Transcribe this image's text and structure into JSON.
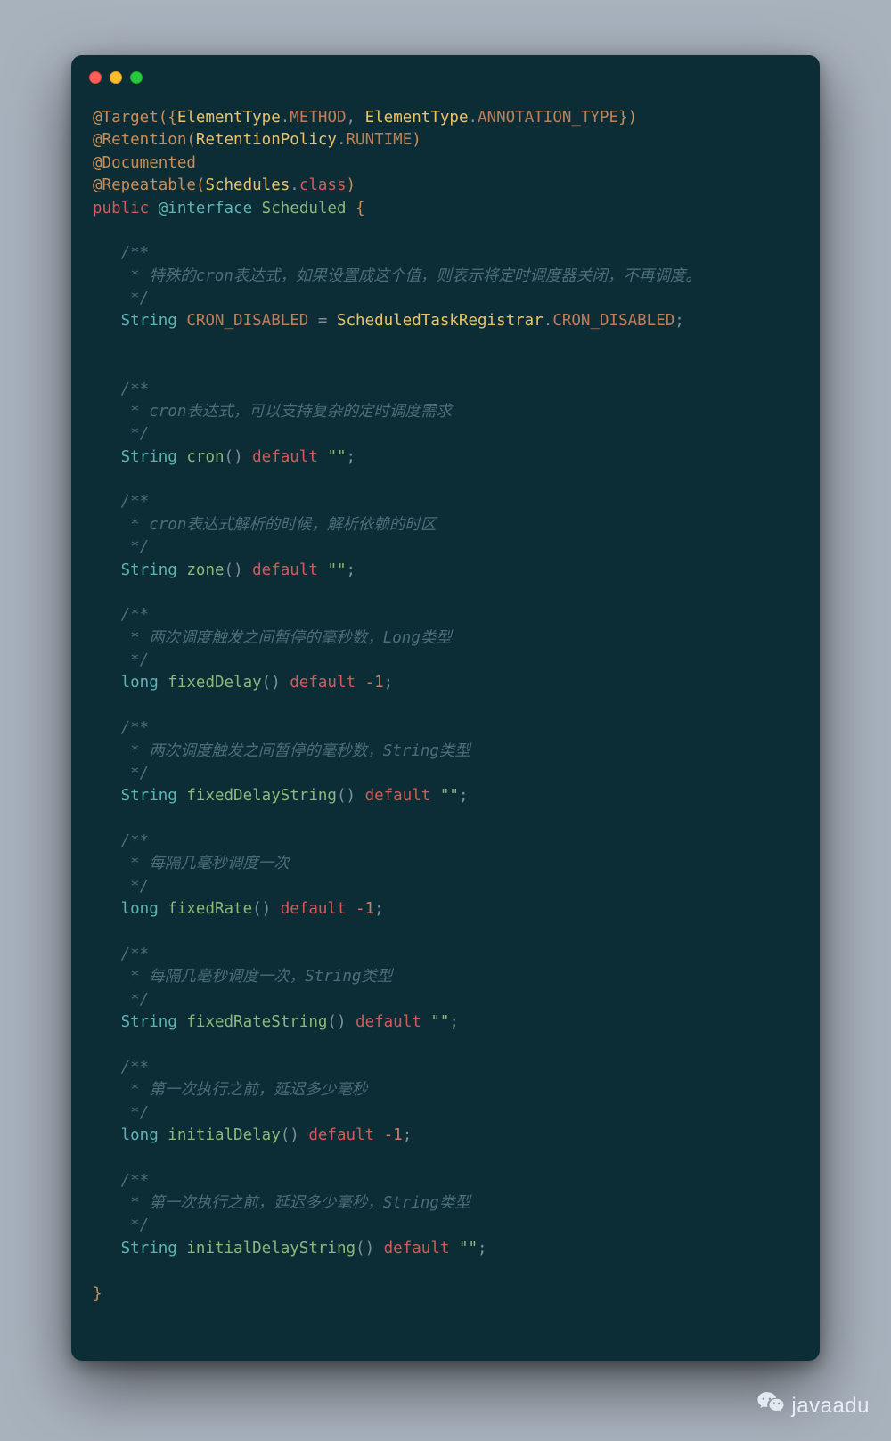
{
  "watermark_text": "javaadu",
  "code": {
    "line1": {
      "at": "@Target",
      "paren_open": "({",
      "t1": "ElementType",
      "dot1": ".",
      "c1": "METHOD",
      "comma": ", ",
      "t2": "ElementType",
      "dot2": ".",
      "c2": "ANNOTATION_TYPE",
      "paren_close": "})"
    },
    "line2": {
      "at": "@Retention",
      "paren_open": "(",
      "t": "RetentionPolicy",
      "dot": ".",
      "c": "RUNTIME",
      "paren_close": ")"
    },
    "line3": {
      "at": "@Documented"
    },
    "line4": {
      "at": "@Repeatable",
      "paren_open": "(",
      "t": "Schedules",
      "dot": ".",
      "c": "class",
      "paren_close": ")"
    },
    "line5": {
      "public": "public ",
      "ainterface": "@interface ",
      "name": "Scheduled ",
      "brace_open": "{"
    },
    "member1": {
      "comment_open": "/**",
      "comment_body": " * 特殊的cron表达式，如果设置成这个值，则表示将定时调度器关闭，不再调度。",
      "comment_close": " */",
      "type": "String ",
      "name": "CRON_DISABLED ",
      "eq": "= ",
      "rhs1": "ScheduledTaskRegistrar",
      "dot": ".",
      "rhs2": "CRON_DISABLED",
      "semi": ";"
    },
    "member2": {
      "comment_open": "/**",
      "comment_body": " * cron表达式，可以支持复杂的定时调度需求",
      "comment_close": " */",
      "type": "String ",
      "name": "cron",
      "parens": "() ",
      "default": "default ",
      "val": "\"\"",
      "semi": ";"
    },
    "member3": {
      "comment_open": "/**",
      "comment_body": " * cron表达式解析的时候，解析依赖的时区",
      "comment_close": " */",
      "type": "String ",
      "name": "zone",
      "parens": "() ",
      "default": "default ",
      "val": "\"\"",
      "semi": ";"
    },
    "member4": {
      "comment_open": "/**",
      "comment_body": " * 两次调度触发之间暂停的毫秒数，Long类型",
      "comment_close": " */",
      "type": "long ",
      "name": "fixedDelay",
      "parens": "() ",
      "default": "default ",
      "val": "-1",
      "semi": ";"
    },
    "member5": {
      "comment_open": "/**",
      "comment_body": " * 两次调度触发之间暂停的毫秒数，String类型",
      "comment_close": " */",
      "type": "String ",
      "name": "fixedDelayString",
      "parens": "() ",
      "default": "default ",
      "val": "\"\"",
      "semi": ";"
    },
    "member6": {
      "comment_open": "/**",
      "comment_body": " * 每隔几毫秒调度一次",
      "comment_close": " */",
      "type": "long ",
      "name": "fixedRate",
      "parens": "() ",
      "default": "default ",
      "val": "-1",
      "semi": ";"
    },
    "member7": {
      "comment_open": "/**",
      "comment_body": " * 每隔几毫秒调度一次，String类型",
      "comment_close": " */",
      "type": "String ",
      "name": "fixedRateString",
      "parens": "() ",
      "default": "default ",
      "val": "\"\"",
      "semi": ";"
    },
    "member8": {
      "comment_open": "/**",
      "comment_body": " * 第一次执行之前，延迟多少毫秒",
      "comment_close": " */",
      "type": "long ",
      "name": "initialDelay",
      "parens": "() ",
      "default": "default ",
      "val": "-1",
      "semi": ";"
    },
    "member9": {
      "comment_open": "/**",
      "comment_body": " * 第一次执行之前，延迟多少毫秒，String类型",
      "comment_close": " */",
      "type": "String ",
      "name": "initialDelayString",
      "parens": "() ",
      "default": "default ",
      "val": "\"\"",
      "semi": ";"
    },
    "brace_close": "}"
  }
}
